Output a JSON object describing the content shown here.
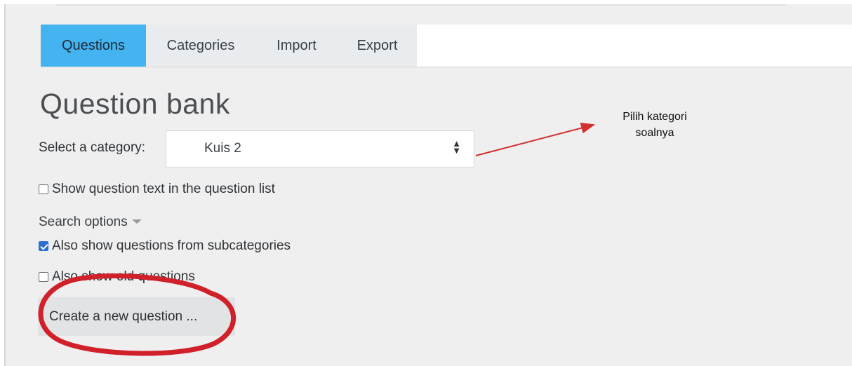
{
  "tabs": [
    {
      "label": "Questions",
      "active": true
    },
    {
      "label": "Categories",
      "active": false
    },
    {
      "label": "Import",
      "active": false
    },
    {
      "label": "Export",
      "active": false
    }
  ],
  "page": {
    "title": "Question bank"
  },
  "category": {
    "label": "Select a category:",
    "selected": "Kuis 2"
  },
  "options": {
    "show_text_label": "Show question text in the question list",
    "show_text_checked": false,
    "search_options_label": "Search options",
    "subcategories_label": "Also show questions from subcategories",
    "subcategories_checked": true,
    "old_questions_label": "Also show old questions",
    "old_questions_checked": false
  },
  "actions": {
    "create_label": "Create a new question ..."
  },
  "annotation": {
    "line1": "Pilih kategori",
    "line2": "soalnya",
    "color": "#d32f2f"
  },
  "colors": {
    "active_tab": "#44b4f0",
    "checkbox_checked": "#2f6fd1",
    "highlight_circle": "#d0202a"
  }
}
